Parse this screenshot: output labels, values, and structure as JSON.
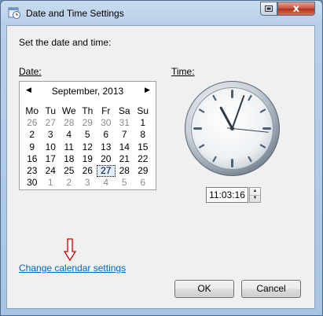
{
  "window": {
    "title": "Date and Time Settings",
    "close_glyph": "x"
  },
  "heading": "Set the date and time:",
  "date_label": "Date:",
  "time_label": "Time:",
  "calendar": {
    "month_label": "September, 2013",
    "prev_glyph": "◀",
    "next_glyph": "▶",
    "weekdays": [
      "Mo",
      "Tu",
      "We",
      "Th",
      "Fr",
      "Sa",
      "Su"
    ],
    "weeks": [
      [
        {
          "d": "26",
          "o": true
        },
        {
          "d": "27",
          "o": true
        },
        {
          "d": "28",
          "o": true
        },
        {
          "d": "29",
          "o": true
        },
        {
          "d": "30",
          "o": true
        },
        {
          "d": "31",
          "o": true
        },
        {
          "d": "1",
          "o": false
        }
      ],
      [
        {
          "d": "2",
          "o": false
        },
        {
          "d": "3",
          "o": false
        },
        {
          "d": "4",
          "o": false
        },
        {
          "d": "5",
          "o": false
        },
        {
          "d": "6",
          "o": false
        },
        {
          "d": "7",
          "o": false
        },
        {
          "d": "8",
          "o": false
        }
      ],
      [
        {
          "d": "9",
          "o": false
        },
        {
          "d": "10",
          "o": false
        },
        {
          "d": "11",
          "o": false
        },
        {
          "d": "12",
          "o": false
        },
        {
          "d": "13",
          "o": false
        },
        {
          "d": "14",
          "o": false
        },
        {
          "d": "15",
          "o": false
        }
      ],
      [
        {
          "d": "16",
          "o": false
        },
        {
          "d": "17",
          "o": false
        },
        {
          "d": "18",
          "o": false
        },
        {
          "d": "19",
          "o": false
        },
        {
          "d": "20",
          "o": false
        },
        {
          "d": "21",
          "o": false
        },
        {
          "d": "22",
          "o": false
        }
      ],
      [
        {
          "d": "23",
          "o": false
        },
        {
          "d": "24",
          "o": false
        },
        {
          "d": "25",
          "o": false
        },
        {
          "d": "26",
          "o": false
        },
        {
          "d": "27",
          "o": false,
          "sel": true
        },
        {
          "d": "28",
          "o": false
        },
        {
          "d": "29",
          "o": false
        }
      ],
      [
        {
          "d": "30",
          "o": false
        },
        {
          "d": "1",
          "o": true
        },
        {
          "d": "2",
          "o": true
        },
        {
          "d": "3",
          "o": true
        },
        {
          "d": "4",
          "o": true
        },
        {
          "d": "5",
          "o": true
        },
        {
          "d": "6",
          "o": true
        }
      ]
    ],
    "selected_date": "27"
  },
  "clock": {
    "hour": 11,
    "minute": 3,
    "second": 16
  },
  "time_value": "11:03:16",
  "link_text": "Change calendar settings",
  "buttons": {
    "ok": "OK",
    "cancel": "Cancel"
  },
  "colors": {
    "link": "#0066cc",
    "arrow": "#cc0000",
    "close_button": "#c7503d"
  },
  "icons": {
    "app": "clock-calendar-icon",
    "help": "help-icon",
    "close": "close-icon",
    "arrow": "red-down-arrow-icon"
  }
}
